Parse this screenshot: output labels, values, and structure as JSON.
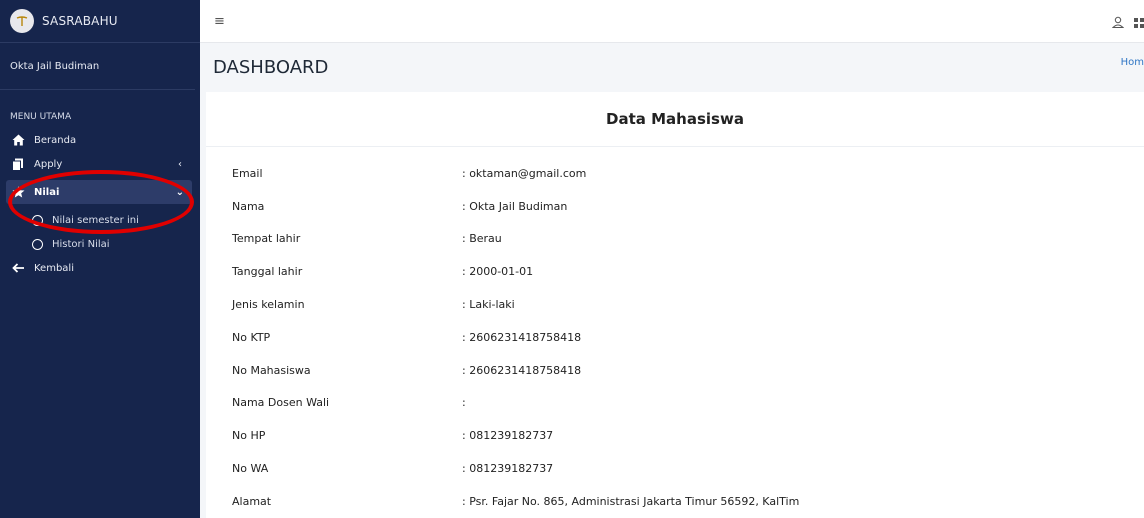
{
  "brand": {
    "name": "SASRABAHU"
  },
  "user": {
    "name": "Okta Jail Budiman"
  },
  "menu": {
    "header": "MENU UTAMA",
    "items": [
      {
        "label": "Beranda",
        "icon": "home-icon"
      },
      {
        "label": "Apply",
        "icon": "copy-icon",
        "chevron": "‹"
      },
      {
        "label": "Nilai",
        "icon": "star-icon",
        "chevron": "⌄"
      }
    ],
    "sub_items": [
      {
        "label": "Nilai semester ini"
      },
      {
        "label": "Histori Nilai"
      }
    ],
    "back": {
      "label": "Kembali",
      "icon": "arrow-left-icon"
    }
  },
  "header": {
    "title": "DASHBOARD",
    "breadcrumb": "Hom"
  },
  "card": {
    "title": "Data Mahasiswa",
    "rows": [
      {
        "key": "Email",
        "value": ": oktaman@gmail.com"
      },
      {
        "key": "Nama",
        "value": ": Okta Jail Budiman"
      },
      {
        "key": "Tempat lahir",
        "value": ": Berau"
      },
      {
        "key": "Tanggal lahir",
        "value": ": 2000-01-01"
      },
      {
        "key": "Jenis kelamin",
        "value": ": Laki-laki"
      },
      {
        "key": "No KTP",
        "value": ": 2606231418758418"
      },
      {
        "key": "No Mahasiswa",
        "value": ": 2606231418758418"
      },
      {
        "key": "Nama Dosen Wali",
        "value": ":"
      },
      {
        "key": "No HP",
        "value": ": 081239182737"
      },
      {
        "key": "No WA",
        "value": ": 081239182737"
      },
      {
        "key": "Alamat",
        "value": ": Psr. Fajar No. 865, Administrasi Jakarta Timur 56592, KalTim"
      }
    ]
  },
  "colors": {
    "sidebar": "#16254c",
    "active_item": "#2d3c69",
    "annotation": "#e00000",
    "link": "#2f76c5"
  }
}
